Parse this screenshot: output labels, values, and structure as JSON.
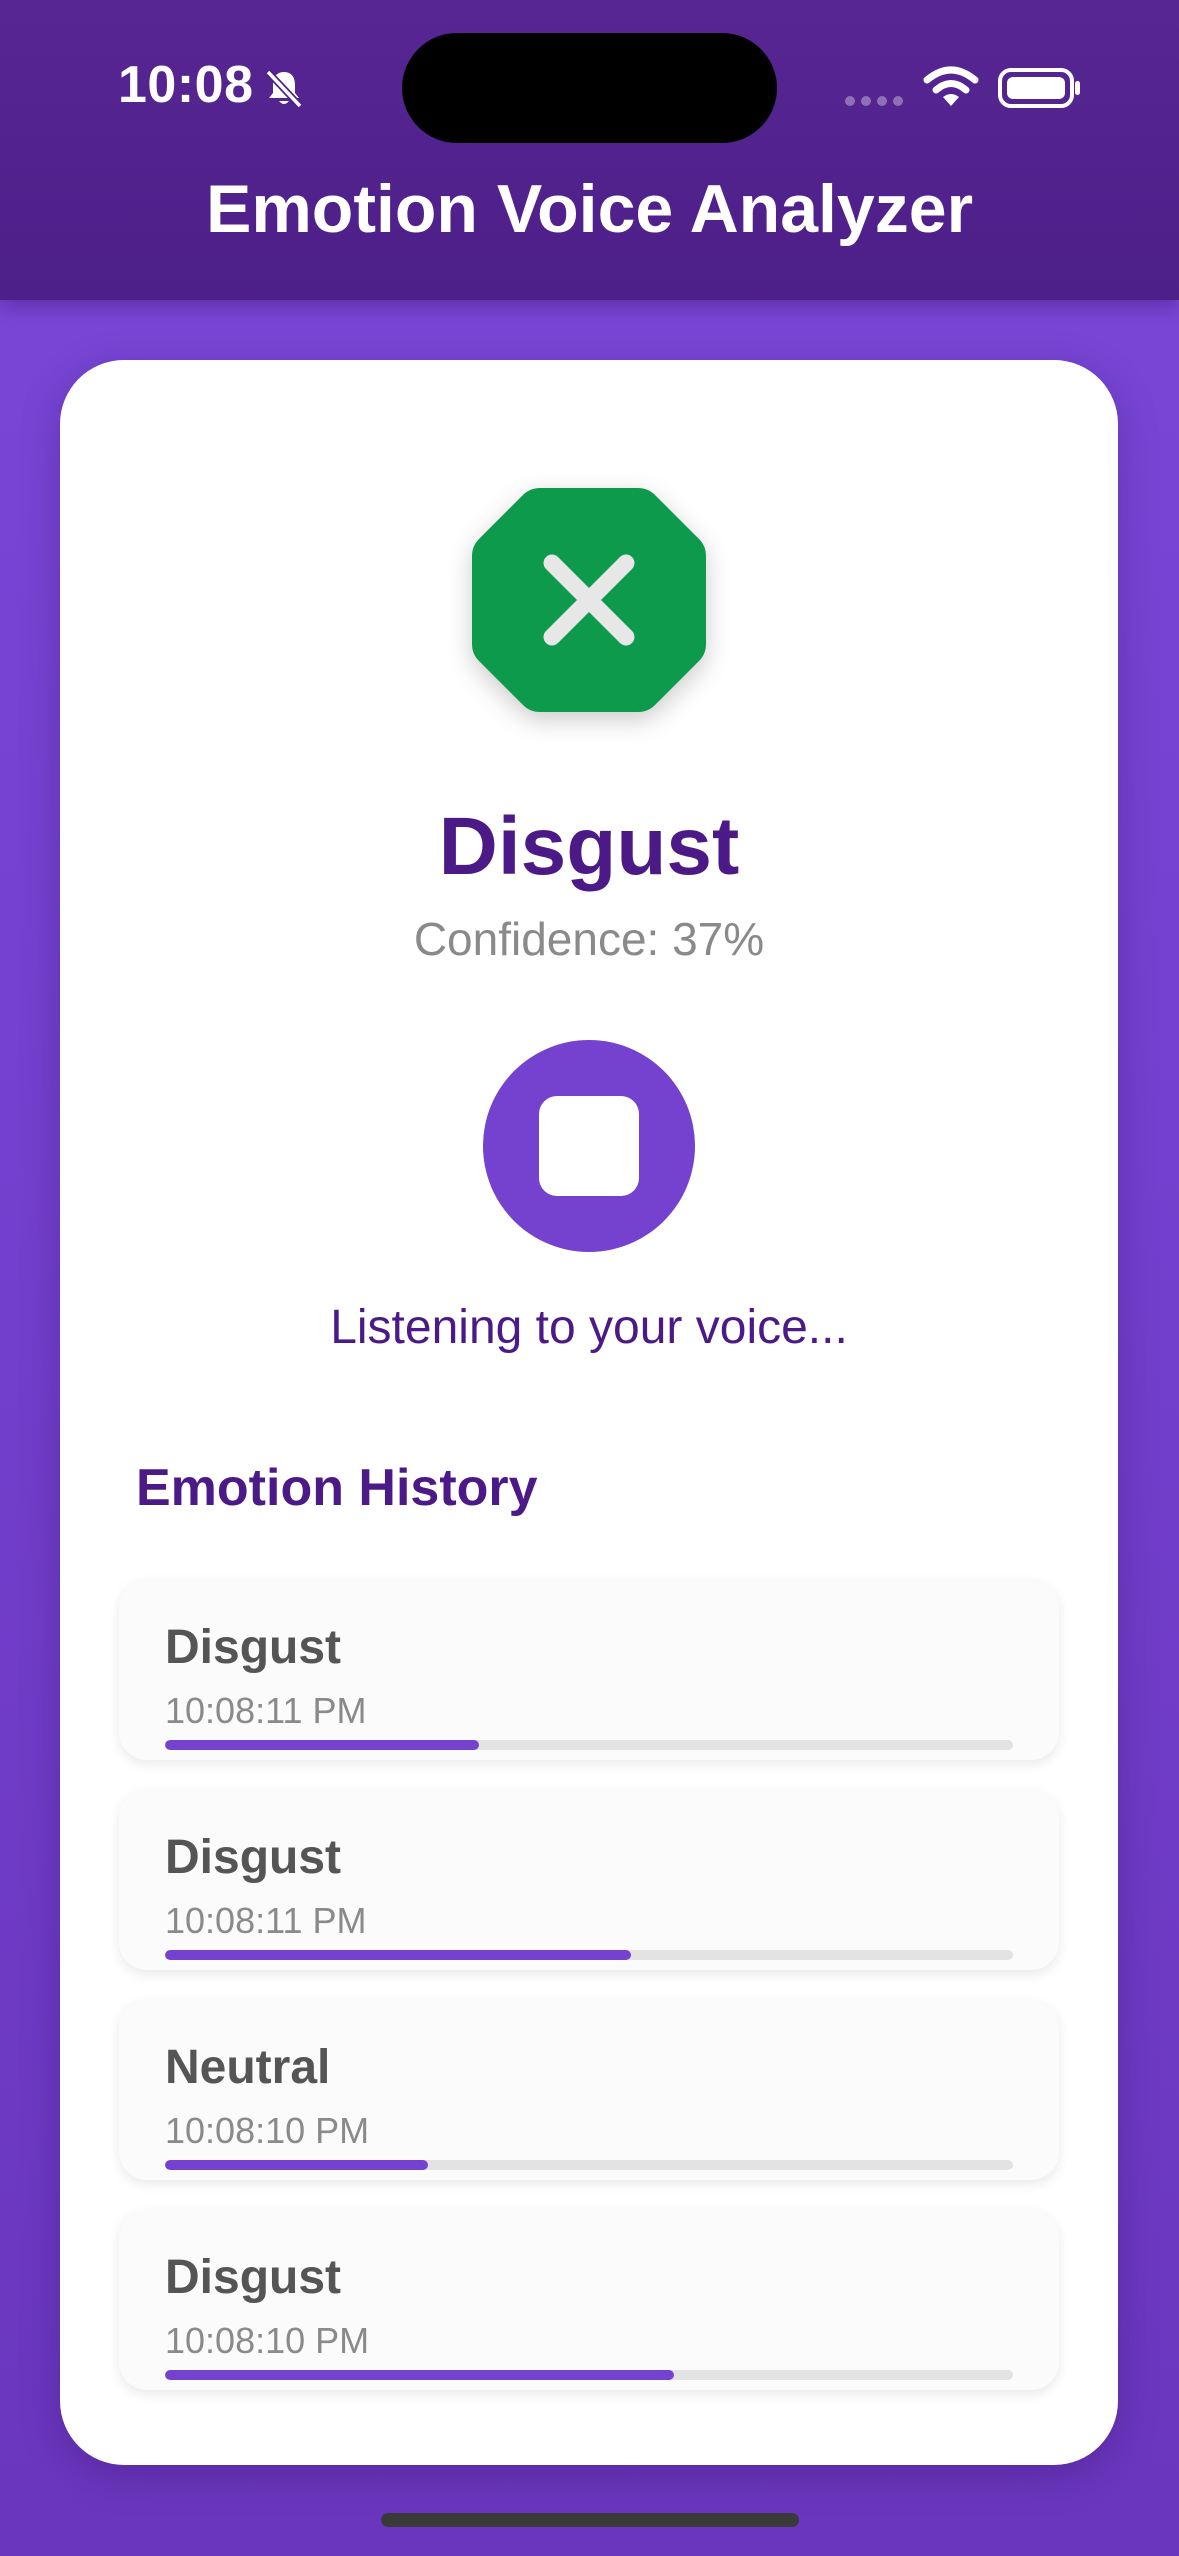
{
  "status_bar": {
    "time": "10:08",
    "icons": [
      "bell-slash-icon",
      "signal-icon",
      "wifi-icon",
      "battery-icon"
    ]
  },
  "header": {
    "title": "Emotion Voice Analyzer"
  },
  "current": {
    "emotion": "Disgust",
    "confidence_text": "Confidence: 37%",
    "icon": "x-octagon-icon",
    "icon_color": "#0e9a4c"
  },
  "recorder": {
    "stop_icon": "stop-icon",
    "status_text": "Listening to your voice..."
  },
  "history": {
    "title": "Emotion History",
    "items": [
      {
        "emotion": "Disgust",
        "time": "10:08:11 PM",
        "confidence": 0.37
      },
      {
        "emotion": "Disgust",
        "time": "10:08:11 PM",
        "confidence": 0.55
      },
      {
        "emotion": "Neutral",
        "time": "10:08:10 PM",
        "confidence": 0.31
      },
      {
        "emotion": "Disgust",
        "time": "10:08:10 PM",
        "confidence": 0.6
      }
    ]
  },
  "colors": {
    "accent": "#7442cf",
    "header": "#4d1f88",
    "title_text": "#4b1a87",
    "emotion_green": "#0e9a4c"
  }
}
